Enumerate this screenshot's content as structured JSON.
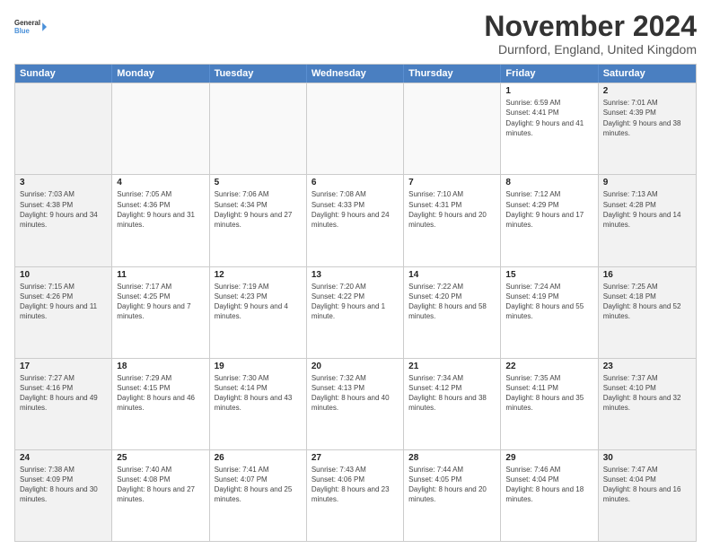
{
  "logo": {
    "line1": "General",
    "line2": "Blue"
  },
  "header": {
    "month": "November 2024",
    "location": "Durnford, England, United Kingdom"
  },
  "weekdays": [
    "Sunday",
    "Monday",
    "Tuesday",
    "Wednesday",
    "Thursday",
    "Friday",
    "Saturday"
  ],
  "rows": [
    [
      {
        "day": "",
        "info": ""
      },
      {
        "day": "",
        "info": ""
      },
      {
        "day": "",
        "info": ""
      },
      {
        "day": "",
        "info": ""
      },
      {
        "day": "",
        "info": ""
      },
      {
        "day": "1",
        "info": "Sunrise: 6:59 AM\nSunset: 4:41 PM\nDaylight: 9 hours and 41 minutes."
      },
      {
        "day": "2",
        "info": "Sunrise: 7:01 AM\nSunset: 4:39 PM\nDaylight: 9 hours and 38 minutes."
      }
    ],
    [
      {
        "day": "3",
        "info": "Sunrise: 7:03 AM\nSunset: 4:38 PM\nDaylight: 9 hours and 34 minutes."
      },
      {
        "day": "4",
        "info": "Sunrise: 7:05 AM\nSunset: 4:36 PM\nDaylight: 9 hours and 31 minutes."
      },
      {
        "day": "5",
        "info": "Sunrise: 7:06 AM\nSunset: 4:34 PM\nDaylight: 9 hours and 27 minutes."
      },
      {
        "day": "6",
        "info": "Sunrise: 7:08 AM\nSunset: 4:33 PM\nDaylight: 9 hours and 24 minutes."
      },
      {
        "day": "7",
        "info": "Sunrise: 7:10 AM\nSunset: 4:31 PM\nDaylight: 9 hours and 20 minutes."
      },
      {
        "day": "8",
        "info": "Sunrise: 7:12 AM\nSunset: 4:29 PM\nDaylight: 9 hours and 17 minutes."
      },
      {
        "day": "9",
        "info": "Sunrise: 7:13 AM\nSunset: 4:28 PM\nDaylight: 9 hours and 14 minutes."
      }
    ],
    [
      {
        "day": "10",
        "info": "Sunrise: 7:15 AM\nSunset: 4:26 PM\nDaylight: 9 hours and 11 minutes."
      },
      {
        "day": "11",
        "info": "Sunrise: 7:17 AM\nSunset: 4:25 PM\nDaylight: 9 hours and 7 minutes."
      },
      {
        "day": "12",
        "info": "Sunrise: 7:19 AM\nSunset: 4:23 PM\nDaylight: 9 hours and 4 minutes."
      },
      {
        "day": "13",
        "info": "Sunrise: 7:20 AM\nSunset: 4:22 PM\nDaylight: 9 hours and 1 minute."
      },
      {
        "day": "14",
        "info": "Sunrise: 7:22 AM\nSunset: 4:20 PM\nDaylight: 8 hours and 58 minutes."
      },
      {
        "day": "15",
        "info": "Sunrise: 7:24 AM\nSunset: 4:19 PM\nDaylight: 8 hours and 55 minutes."
      },
      {
        "day": "16",
        "info": "Sunrise: 7:25 AM\nSunset: 4:18 PM\nDaylight: 8 hours and 52 minutes."
      }
    ],
    [
      {
        "day": "17",
        "info": "Sunrise: 7:27 AM\nSunset: 4:16 PM\nDaylight: 8 hours and 49 minutes."
      },
      {
        "day": "18",
        "info": "Sunrise: 7:29 AM\nSunset: 4:15 PM\nDaylight: 8 hours and 46 minutes."
      },
      {
        "day": "19",
        "info": "Sunrise: 7:30 AM\nSunset: 4:14 PM\nDaylight: 8 hours and 43 minutes."
      },
      {
        "day": "20",
        "info": "Sunrise: 7:32 AM\nSunset: 4:13 PM\nDaylight: 8 hours and 40 minutes."
      },
      {
        "day": "21",
        "info": "Sunrise: 7:34 AM\nSunset: 4:12 PM\nDaylight: 8 hours and 38 minutes."
      },
      {
        "day": "22",
        "info": "Sunrise: 7:35 AM\nSunset: 4:11 PM\nDaylight: 8 hours and 35 minutes."
      },
      {
        "day": "23",
        "info": "Sunrise: 7:37 AM\nSunset: 4:10 PM\nDaylight: 8 hours and 32 minutes."
      }
    ],
    [
      {
        "day": "24",
        "info": "Sunrise: 7:38 AM\nSunset: 4:09 PM\nDaylight: 8 hours and 30 minutes."
      },
      {
        "day": "25",
        "info": "Sunrise: 7:40 AM\nSunset: 4:08 PM\nDaylight: 8 hours and 27 minutes."
      },
      {
        "day": "26",
        "info": "Sunrise: 7:41 AM\nSunset: 4:07 PM\nDaylight: 8 hours and 25 minutes."
      },
      {
        "day": "27",
        "info": "Sunrise: 7:43 AM\nSunset: 4:06 PM\nDaylight: 8 hours and 23 minutes."
      },
      {
        "day": "28",
        "info": "Sunrise: 7:44 AM\nSunset: 4:05 PM\nDaylight: 8 hours and 20 minutes."
      },
      {
        "day": "29",
        "info": "Sunrise: 7:46 AM\nSunset: 4:04 PM\nDaylight: 8 hours and 18 minutes."
      },
      {
        "day": "30",
        "info": "Sunrise: 7:47 AM\nSunset: 4:04 PM\nDaylight: 8 hours and 16 minutes."
      }
    ]
  ]
}
